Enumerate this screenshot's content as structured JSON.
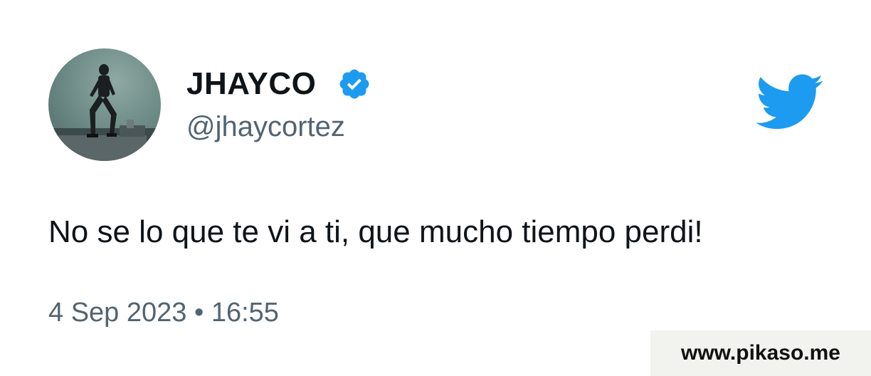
{
  "author": {
    "display_name": "JHAYCO",
    "handle": "@jhaycortez",
    "verified": true
  },
  "tweet": {
    "text": "No se lo que te vi a ti, que mucho tiempo perdi!",
    "date": "4 Sep 2023",
    "separator": "•",
    "time": "16:55"
  },
  "watermark": {
    "text": "www.pikaso.me"
  },
  "icons": {
    "avatar": "avatar-photo",
    "badge": "verified-badge-icon",
    "logo": "twitter-bird-icon"
  },
  "colors": {
    "twitter_blue": "#1d9bf0",
    "text_primary": "#0f1419",
    "text_secondary": "#536471",
    "watermark_bg": "#f2f2ee"
  }
}
